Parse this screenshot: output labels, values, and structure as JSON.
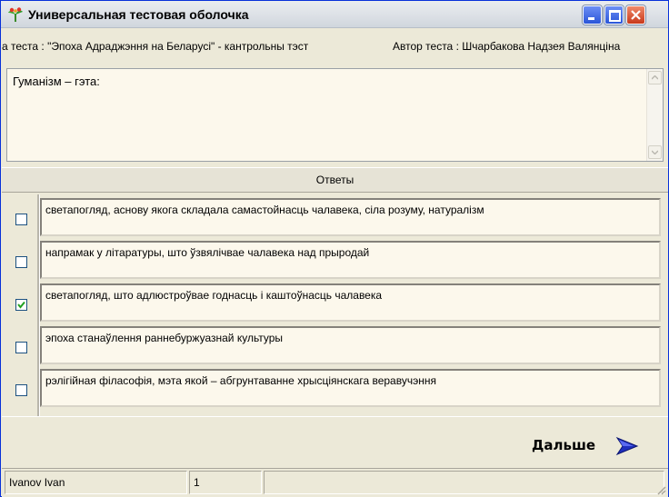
{
  "window": {
    "title": "Универсальная тестовая оболочка"
  },
  "info": {
    "test_title": "а теста : \"Эпоха Адраджэння на Беларусі\" - кантрольны тэст",
    "author": "Автор теста : Шчарбакова Надзея Валянціна"
  },
  "question": {
    "text": "Гуманізм – гэта:"
  },
  "answers_header": "Ответы",
  "answers": [
    {
      "text": "светапогляд, аснову якога складала самастойнасць чалавека, сіла розуму, натуралізм",
      "checked": false
    },
    {
      "text": "напрамак у літаратуры, што ўзвялічвае чалавека над прыродай",
      "checked": false
    },
    {
      "text": "светапогляд, што адлюстроўвае годнасць і каштоўнасць чалавека",
      "checked": true
    },
    {
      "text": "эпоха станаўлення раннебуржуазнай культуры",
      "checked": false
    },
    {
      "text": "рэлігійная філасофія, мэта якой – абгрунтаванне хрысціянскага веравучэння",
      "checked": false
    }
  ],
  "next_button": {
    "label": "Дальше"
  },
  "status": {
    "user": "Ivanov Ivan",
    "number": "1"
  },
  "colors": {
    "panel": "#ece9d8",
    "input_bg": "#fcf8ec",
    "arrow": "#1f2fbd"
  }
}
